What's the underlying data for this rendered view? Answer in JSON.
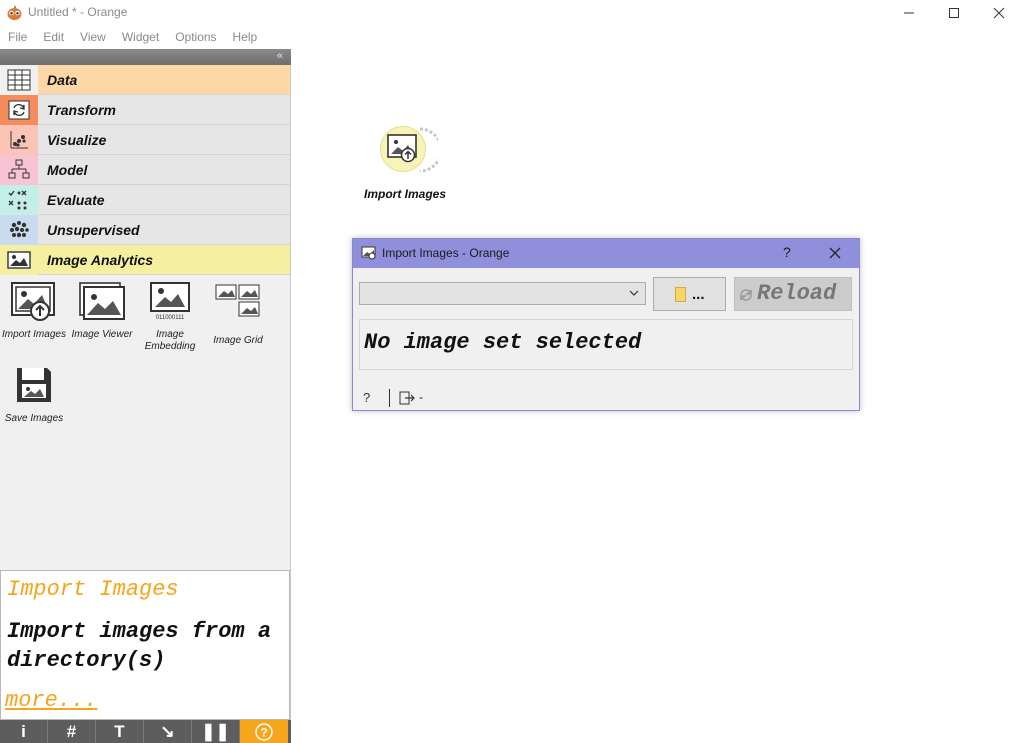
{
  "window": {
    "title": "Untitled * - Orange",
    "controls": [
      "minimize-icon",
      "maximize-icon",
      "close-icon"
    ]
  },
  "menu": [
    "File",
    "Edit",
    "View",
    "Widget",
    "Options",
    "Help"
  ],
  "panel": {
    "collapse_glyph": "«",
    "categories": [
      {
        "label": "Data",
        "icon": "table-icon",
        "color": "#fdd7a5",
        "iconbg": "#f0f0f0"
      },
      {
        "label": "Transform",
        "icon": "transform-icon",
        "color": "#e6e6e6",
        "iconbg": "#f48c5b"
      },
      {
        "label": "Visualize",
        "icon": "scatter-icon",
        "color": "#e6e6e6",
        "iconbg": "#fcc3b7"
      },
      {
        "label": "Model",
        "icon": "tree-icon",
        "color": "#e6e6e6",
        "iconbg": "#f8c4d4"
      },
      {
        "label": "Evaluate",
        "icon": "evaluate-icon",
        "color": "#e6e6e6",
        "iconbg": "#c3efe8"
      },
      {
        "label": "Unsupervised",
        "icon": "cluster-icon",
        "color": "#e6e6e6",
        "iconbg": "#c9dbef"
      },
      {
        "label": "Image Analytics",
        "icon": "image-icon",
        "color": "#f5f0a0",
        "iconbg": "#f5f0a0"
      }
    ],
    "widgets": [
      {
        "label": "Import Images",
        "icon": "import-images-icon"
      },
      {
        "label": "Image Viewer",
        "icon": "image-viewer-icon"
      },
      {
        "label": "Image Embedding",
        "icon": "image-embedding-icon",
        "embed_text": "011000111"
      },
      {
        "label": "Image Grid",
        "icon": "image-grid-icon"
      },
      {
        "label": "Save Images",
        "icon": "save-images-icon"
      }
    ]
  },
  "description": {
    "title": "Import Images",
    "text": "Import images from a directory(s)",
    "more": "more..."
  },
  "toolbar": {
    "buttons": [
      "i",
      "#",
      "T",
      "↘",
      "❚❚",
      "?"
    ],
    "highlight_color": "#f7a51b"
  },
  "canvas": {
    "node_label": "Import Images"
  },
  "dialog": {
    "title": "Import Images - Orange",
    "help": "?",
    "combo_value": "",
    "browse_label": "...",
    "reload_label": "Reload",
    "status": "No image set selected",
    "footer_help": "?",
    "output_text": "-"
  }
}
